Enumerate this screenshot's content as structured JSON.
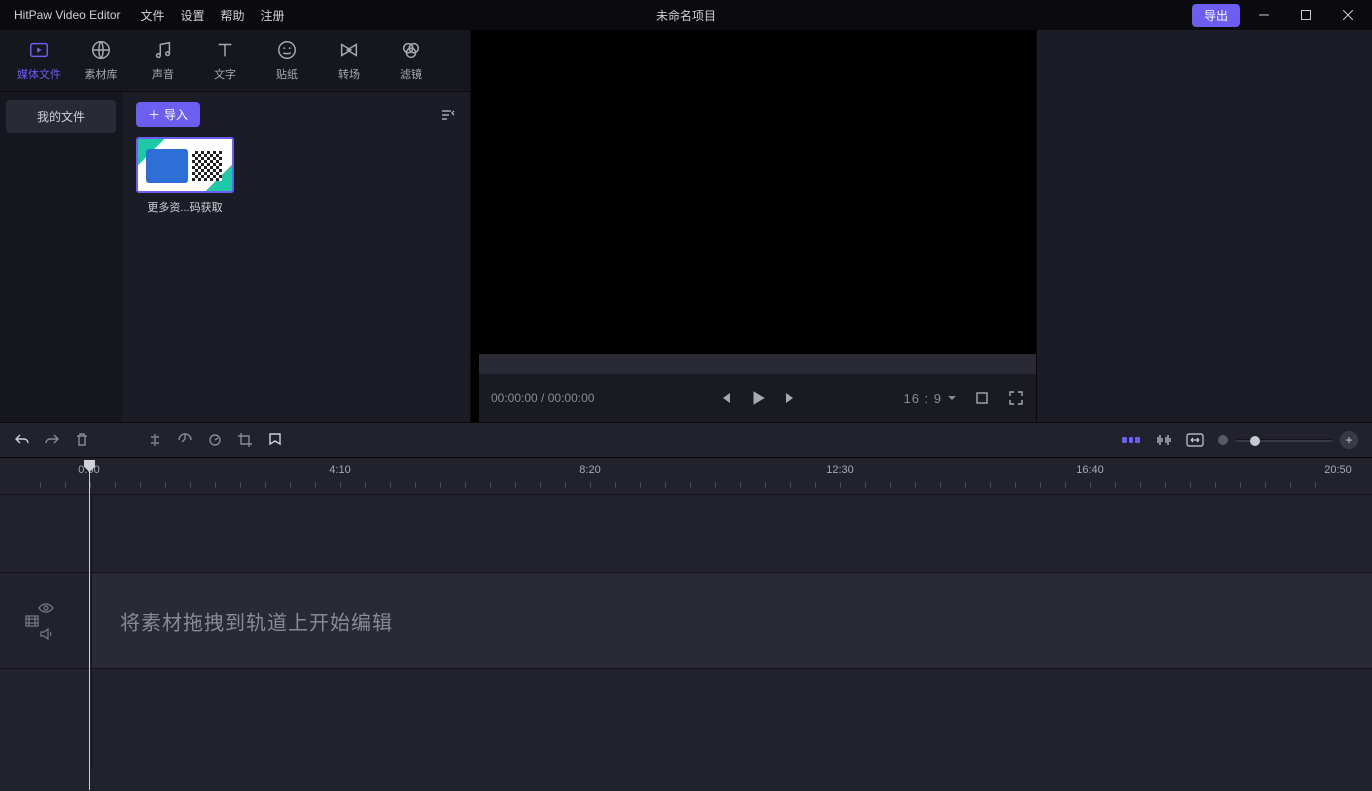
{
  "titlebar": {
    "app_name": "HitPaw Video Editor",
    "menu": {
      "file": "文件",
      "settings": "设置",
      "help": "帮助",
      "register": "注册"
    },
    "project_title": "未命名项目",
    "export_label": "导出"
  },
  "tabs": {
    "media": "媒体文件",
    "library": "素材库",
    "audio": "声音",
    "text": "文字",
    "sticker": "贴纸",
    "transition": "转场",
    "filter": "滤镜"
  },
  "sidebar": {
    "my_files": "我的文件"
  },
  "media": {
    "import_label": "导入",
    "items": [
      {
        "label": "更多资...码获取"
      }
    ]
  },
  "preview": {
    "time_current": "00:00:00",
    "time_total": "00:00:00",
    "aspect_ratio": "16 : 9"
  },
  "timeline": {
    "ruler": [
      "0:00",
      "4:10",
      "8:20",
      "12:30",
      "16:40",
      "20:50"
    ],
    "drop_hint": "将素材拖拽到轨道上开始编辑"
  }
}
